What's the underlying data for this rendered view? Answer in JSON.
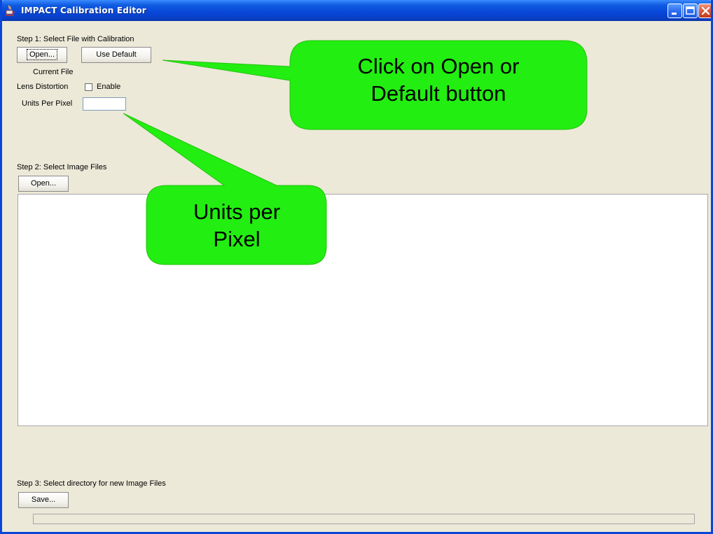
{
  "window": {
    "title": "IMPACT Calibration Editor",
    "app_icon": "java-cup-icon",
    "controls": [
      "minimize-icon",
      "maximize-icon",
      "close-icon"
    ],
    "accent_color": "#0a46d8"
  },
  "step1": {
    "heading": "Step 1: Select File with Calibration",
    "open_label": "Open...",
    "default_label": "Use Default",
    "current_file_label": "Current File",
    "lens_distortion_label": "Lens Distortion",
    "enable_label": "Enable",
    "enable_checked": false,
    "units_per_pixel_label": "Units Per Pixel",
    "units_per_pixel_value": ""
  },
  "step2": {
    "heading": "Step 2: Select Image Files",
    "open_label": "Open...",
    "image_files": []
  },
  "step3": {
    "heading": "Step 3: Select directory for new Image Files",
    "save_label": "Save...",
    "progress": 0
  },
  "callouts": {
    "open_default": {
      "line1": "Click on Open or",
      "line2": "Default button",
      "color": "#22ee11"
    },
    "units_per_pixel": {
      "line1": "Units per",
      "line2": "Pixel",
      "color": "#22ee11"
    }
  }
}
